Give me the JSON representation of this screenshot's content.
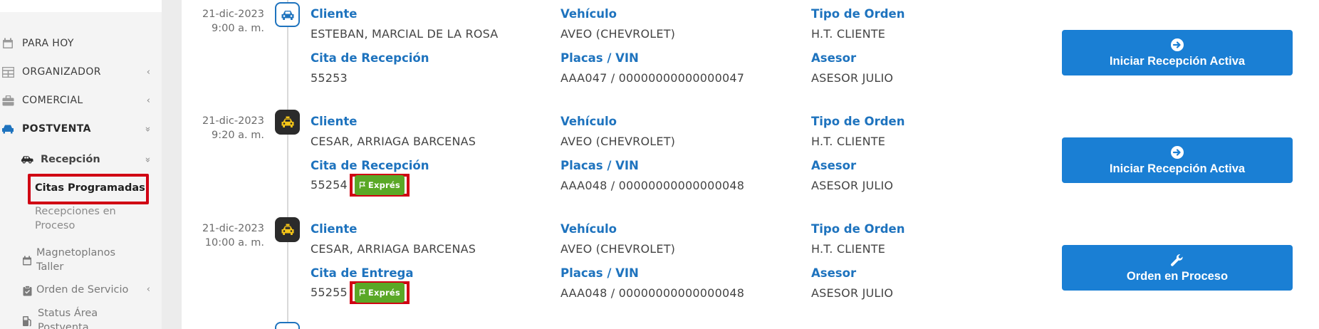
{
  "sidebar": {
    "items": [
      {
        "label": "PARA HOY",
        "icon": "calendar-icon"
      },
      {
        "label": "ORGANIZADOR",
        "icon": "grid-icon"
      },
      {
        "label": "COMERCIAL",
        "icon": "briefcase-icon"
      },
      {
        "label": "POSTVENTA",
        "icon": "car-icon"
      }
    ],
    "recepcion": {
      "label": "Recepción",
      "icon": "car-icon"
    },
    "leaves": {
      "citas": "Citas Programadas",
      "recepciones_l1": "Recepciones en",
      "recepciones_l2": "Proceso"
    },
    "sub2": [
      {
        "label_l1": "Magnetoplanos",
        "label_l2": "Taller",
        "icon": "calendar-icon"
      },
      {
        "label_l1": "Orden de Servicio",
        "icon": "clipboard-icon"
      },
      {
        "label_l1": "Status Área",
        "label_l2": "Postventa",
        "icon": "fuel-icon"
      }
    ],
    "chevron_left": "‹",
    "chevron_down": "»"
  },
  "entries": [
    {
      "date": "21-dic-2023",
      "time": "9:00 a. m.",
      "icon_style": "blue",
      "cliente_label": "Cliente",
      "cliente": "ESTEBAN, MARCIAL DE LA ROSA",
      "cita_label": "Cita de Recepción",
      "cita": "55253",
      "badge": "",
      "vehiculo_label": "Vehículo",
      "vehiculo": "AVEO (CHEVROLET)",
      "placas_label": "Placas / VIN",
      "placas": "AAA047 / 00000000000000047",
      "tipo_label": "Tipo de Orden",
      "tipo": "H.T. CLIENTE",
      "asesor_label": "Asesor",
      "asesor": "ASESOR JULIO",
      "button": "Iniciar Recepción Activa",
      "button_icon": "arrow-right-circle-icon"
    },
    {
      "date": "21-dic-2023",
      "time": "9:20 a. m.",
      "icon_style": "dark",
      "cliente_label": "Cliente",
      "cliente": "CESAR, ARRIAGA BARCENAS",
      "cita_label": "Cita de Recepción",
      "cita": "55254",
      "badge": "Exprés",
      "vehiculo_label": "Vehículo",
      "vehiculo": "AVEO (CHEVROLET)",
      "placas_label": "Placas / VIN",
      "placas": "AAA048 / 00000000000000048",
      "tipo_label": "Tipo de Orden",
      "tipo": "H.T. CLIENTE",
      "asesor_label": "Asesor",
      "asesor": "ASESOR JULIO",
      "button": "Iniciar Recepción Activa",
      "button_icon": "arrow-right-circle-icon"
    },
    {
      "date": "21-dic-2023",
      "time": "10:00 a. m.",
      "icon_style": "dark",
      "cliente_label": "Cliente",
      "cliente": "CESAR, ARRIAGA BARCENAS",
      "cita_label": "Cita de Entrega",
      "cita": "55255",
      "badge": "Exprés",
      "vehiculo_label": "Vehículo",
      "vehiculo": "AVEO (CHEVROLET)",
      "placas_label": "Placas / VIN",
      "placas": "AAA048 / 00000000000000048",
      "tipo_label": "Tipo de Orden",
      "tipo": "H.T. CLIENTE",
      "asesor_label": "Asesor",
      "asesor": "ASESOR JULIO",
      "button": "Orden en Proceso",
      "button_icon": "wrench-icon"
    }
  ],
  "colors": {
    "accent": "#1e73be",
    "button": "#1a7fd4",
    "badge": "#5aa826",
    "highlight": "#d00013",
    "taxi_yellow": "#f5c518"
  }
}
